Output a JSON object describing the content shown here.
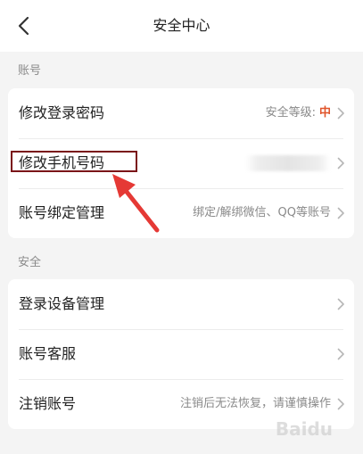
{
  "header": {
    "title": "安全中心"
  },
  "sections": [
    {
      "label": "账号"
    },
    {
      "label": "安全"
    }
  ],
  "account_rows": [
    {
      "label": "修改登录密码",
      "hint": "安全等级:",
      "level": "中"
    },
    {
      "label": "修改手机号码",
      "hint": ""
    },
    {
      "label": "账号绑定管理",
      "hint": "绑定/解绑微信、QQ等账号"
    }
  ],
  "security_rows": [
    {
      "label": "登录设备管理",
      "hint": ""
    },
    {
      "label": "账号客服",
      "hint": ""
    },
    {
      "label": "注销账号",
      "hint": "注销后无法恢复，请谨慎操作"
    }
  ],
  "watermark": "Baidu",
  "colors": {
    "accent": "#e0542a",
    "highlight": "#7a1418",
    "arrow": "#e53935"
  }
}
